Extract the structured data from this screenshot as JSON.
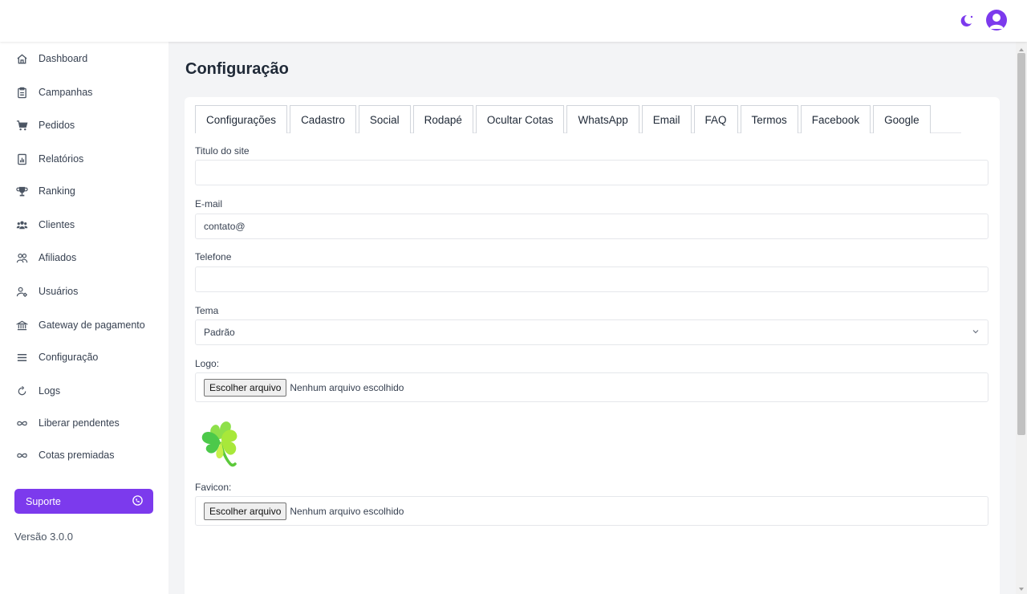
{
  "header": {
    "theme_toggle_icon": "moon-icon",
    "avatar_icon": "user-avatar-icon",
    "accent_color": "#7c3aed"
  },
  "sidebar": {
    "items": [
      {
        "label": "Dashboard",
        "icon": "home-icon"
      },
      {
        "label": "Campanhas",
        "icon": "clipboard-icon"
      },
      {
        "label": "Pedidos",
        "icon": "cart-icon"
      },
      {
        "label": "Relatórios",
        "icon": "report-icon"
      },
      {
        "label": "Ranking",
        "icon": "trophy-icon"
      },
      {
        "label": "Clientes",
        "icon": "users-icon"
      },
      {
        "label": "Afiliados",
        "icon": "affiliates-icon"
      },
      {
        "label": "Usuários",
        "icon": "user-gear-icon"
      },
      {
        "label": "Gateway de pagamento",
        "icon": "payment-gateway-icon"
      },
      {
        "label": "Configuração",
        "icon": "menu-lines-icon"
      },
      {
        "label": "Logs",
        "icon": "refresh-icon"
      },
      {
        "label": "Liberar pendentes",
        "icon": "infinity-icon"
      },
      {
        "label": "Cotas premiadas",
        "icon": "infinity-icon"
      }
    ],
    "support_label": "Suporte",
    "version": "Versão 3.0.0"
  },
  "main": {
    "title": "Configuração",
    "tabs": [
      {
        "label": "Configurações",
        "active": true
      },
      {
        "label": "Cadastro",
        "active": false
      },
      {
        "label": "Social",
        "active": false
      },
      {
        "label": "Rodapé",
        "active": false
      },
      {
        "label": "Ocultar Cotas",
        "active": false
      },
      {
        "label": "WhatsApp",
        "active": false
      },
      {
        "label": "Email",
        "active": false
      },
      {
        "label": "FAQ",
        "active": false
      },
      {
        "label": "Termos",
        "active": false
      },
      {
        "label": "Facebook",
        "active": false
      },
      {
        "label": "Google",
        "active": false
      }
    ],
    "form": {
      "site_title_label": "Titulo do site",
      "site_title_value": "",
      "email_label": "E-mail",
      "email_value": "contato@",
      "phone_label": "Telefone",
      "phone_value": "",
      "theme_label": "Tema",
      "theme_value": "Padrão",
      "logo_label": "Logo:",
      "logo_button": "Escolher arquivo",
      "logo_status": "Nenhum arquivo escolhido",
      "favicon_label": "Favicon:",
      "favicon_button": "Escolher arquivo",
      "favicon_status": "Nenhum arquivo escolhido"
    }
  }
}
